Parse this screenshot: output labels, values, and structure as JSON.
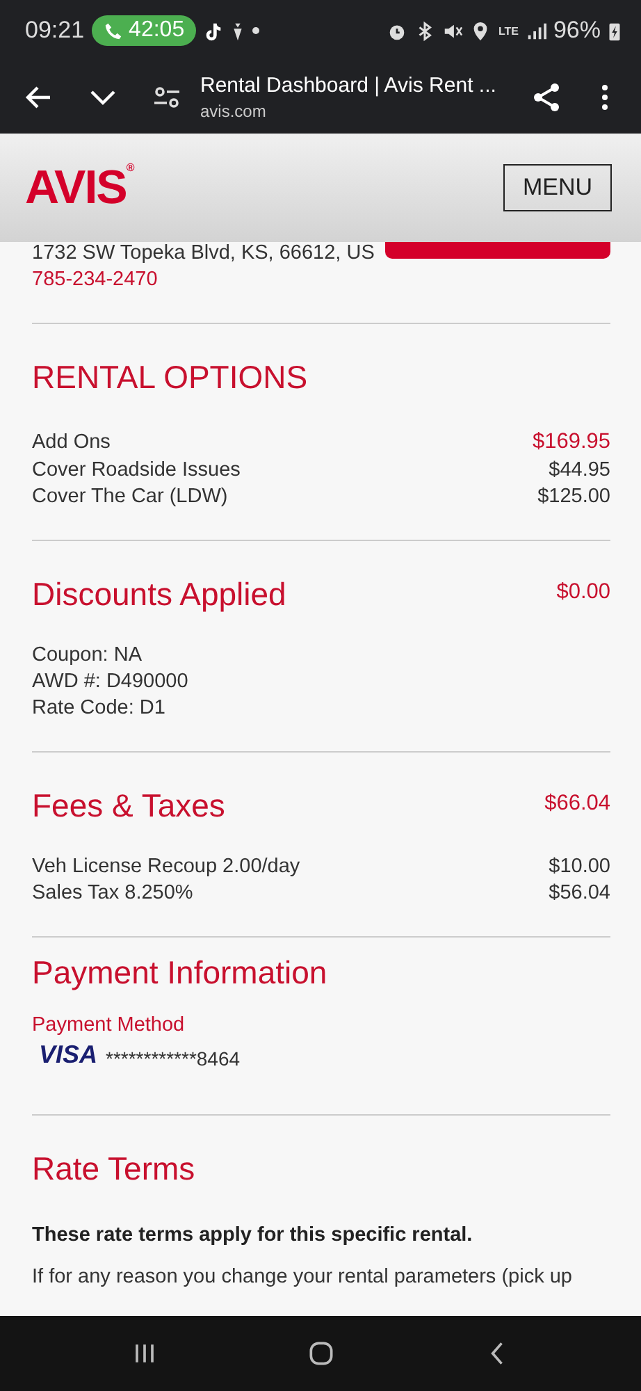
{
  "status_bar": {
    "time": "09:21",
    "call_timer": "42:05",
    "battery": "96%",
    "network": "LTE"
  },
  "browser": {
    "title": "Rental Dashboard | Avis Rent ...",
    "url": "avis.com"
  },
  "header": {
    "logo": "AVIS",
    "logo_mark": "®",
    "menu": "MENU"
  },
  "location": {
    "address": "1732 SW Topeka Blvd, KS, 66612, US",
    "phone": "785-234-2470"
  },
  "rental_options": {
    "title": "RENTAL OPTIONS",
    "rows": [
      {
        "label": "Add Ons",
        "amount": "$169.95",
        "kind": "total"
      },
      {
        "label": "Cover Roadside Issues",
        "amount": "$44.95",
        "kind": "item"
      },
      {
        "label": "Cover The Car (LDW)",
        "amount": "$125.00",
        "kind": "item"
      }
    ]
  },
  "discounts": {
    "title": "Discounts Applied",
    "amount": "$0.00",
    "lines": [
      "Coupon: NA",
      "AWD #: D490000",
      "Rate Code: D1"
    ]
  },
  "fees": {
    "title": "Fees & Taxes",
    "amount": "$66.04",
    "rows": [
      {
        "label": "Veh License Recoup 2.00/day",
        "amount": "$10.00"
      },
      {
        "label": "Sales Tax 8.250%",
        "amount": "$56.04"
      }
    ]
  },
  "payment": {
    "title": "Payment Information",
    "method_label": "Payment Method",
    "card_brand": "VISA",
    "card_number": "************8464"
  },
  "rate_terms": {
    "title": "Rate Terms",
    "lead": "These rate terms apply for this specific rental.",
    "text": "If for any reason you change your rental parameters (pick up"
  }
}
